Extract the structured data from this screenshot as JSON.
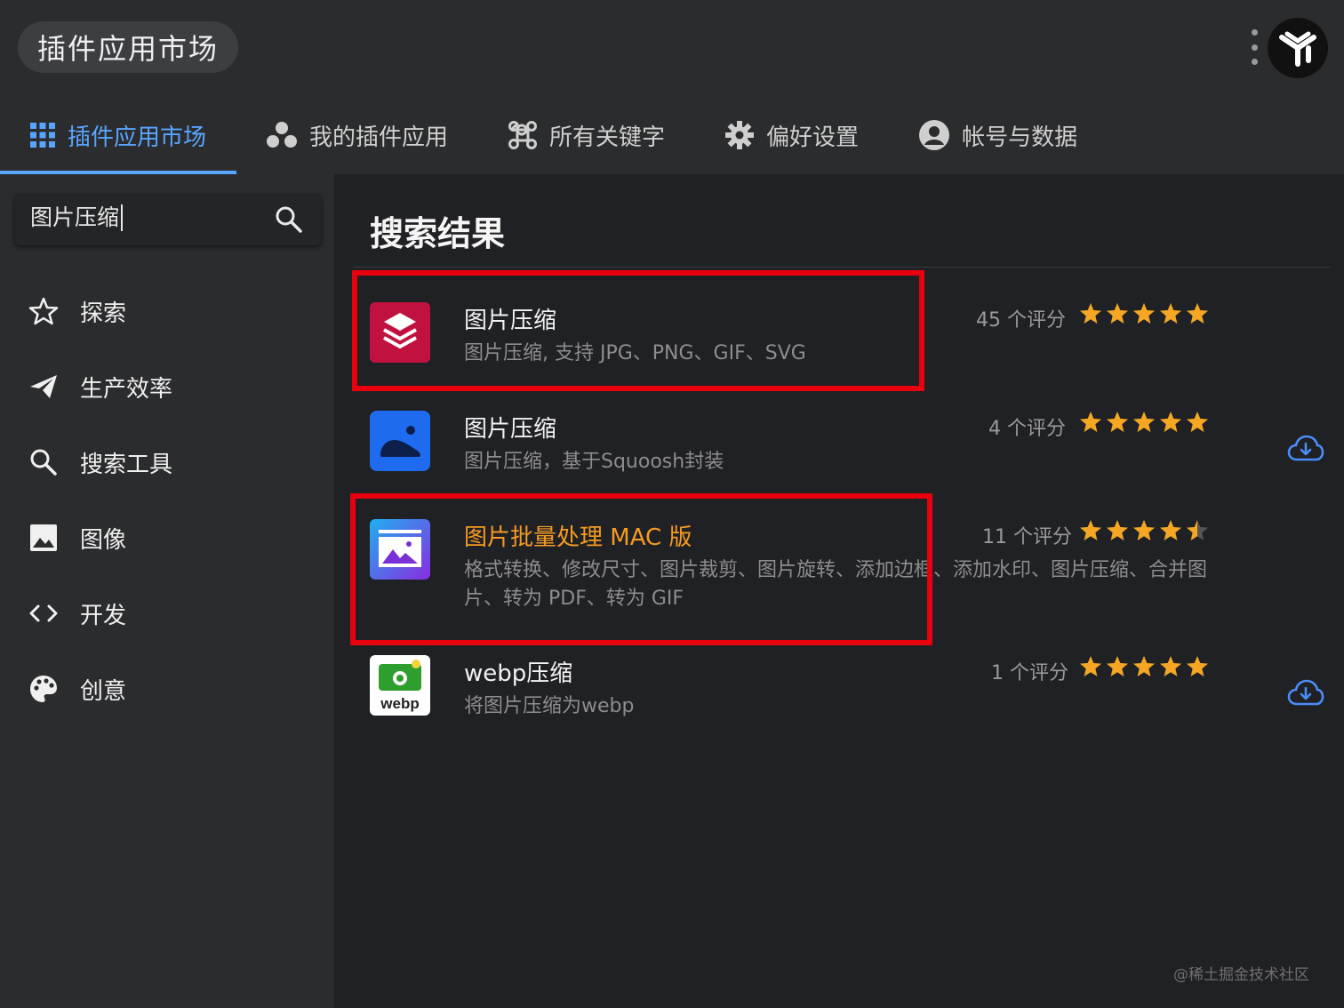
{
  "header": {
    "app_title": "插件应用市场"
  },
  "tabs": [
    {
      "label": "插件应用市场",
      "icon": "grid-icon",
      "active": true
    },
    {
      "label": "我的插件应用",
      "icon": "dots-cluster-icon",
      "active": false
    },
    {
      "label": "所有关键字",
      "icon": "command-icon",
      "active": false
    },
    {
      "label": "偏好设置",
      "icon": "gear-icon",
      "active": false
    },
    {
      "label": "帐号与数据",
      "icon": "account-icon",
      "active": false
    }
  ],
  "search": {
    "value": "图片压缩"
  },
  "sidebar": {
    "items": [
      {
        "label": "探索",
        "icon": "star-outline-icon"
      },
      {
        "label": "生产效率",
        "icon": "paper-plane-icon"
      },
      {
        "label": "搜索工具",
        "icon": "search-icon"
      },
      {
        "label": "图像",
        "icon": "image-icon"
      },
      {
        "label": "开发",
        "icon": "code-icon"
      },
      {
        "label": "创意",
        "icon": "palette-icon"
      }
    ]
  },
  "main": {
    "title": "搜索结果",
    "plugins": [
      {
        "name": "图片压缩",
        "desc": "图片压缩, 支持 JPG、PNG、GIF、SVG",
        "rating_text": "45 个评分",
        "stars": 5,
        "installed": true
      },
      {
        "name": "图片压缩",
        "desc": "图片压缩，基于Squoosh封装",
        "rating_text": "4 个评分",
        "stars": 5,
        "installed": false
      },
      {
        "name": "图片批量处理 MAC 版",
        "desc": "格式转换、修改尺寸、图片裁剪、图片旋转、添加边框、添加水印、图片压缩、合并图片、转为 PDF、转为 GIF",
        "rating_text": "11 个评分",
        "stars": 4.5,
        "installed": true
      },
      {
        "name": "webp压缩",
        "desc": "将图片压缩为webp",
        "rating_text": "1 个评分",
        "stars": 5,
        "installed": false,
        "icon_text": "webp"
      }
    ]
  },
  "colors": {
    "accent": "#58a5ff",
    "highlight": "#e8000f",
    "star": "#f5a623",
    "plugin3_name": "#f59a23"
  },
  "watermark": "@稀土掘金技术社区"
}
